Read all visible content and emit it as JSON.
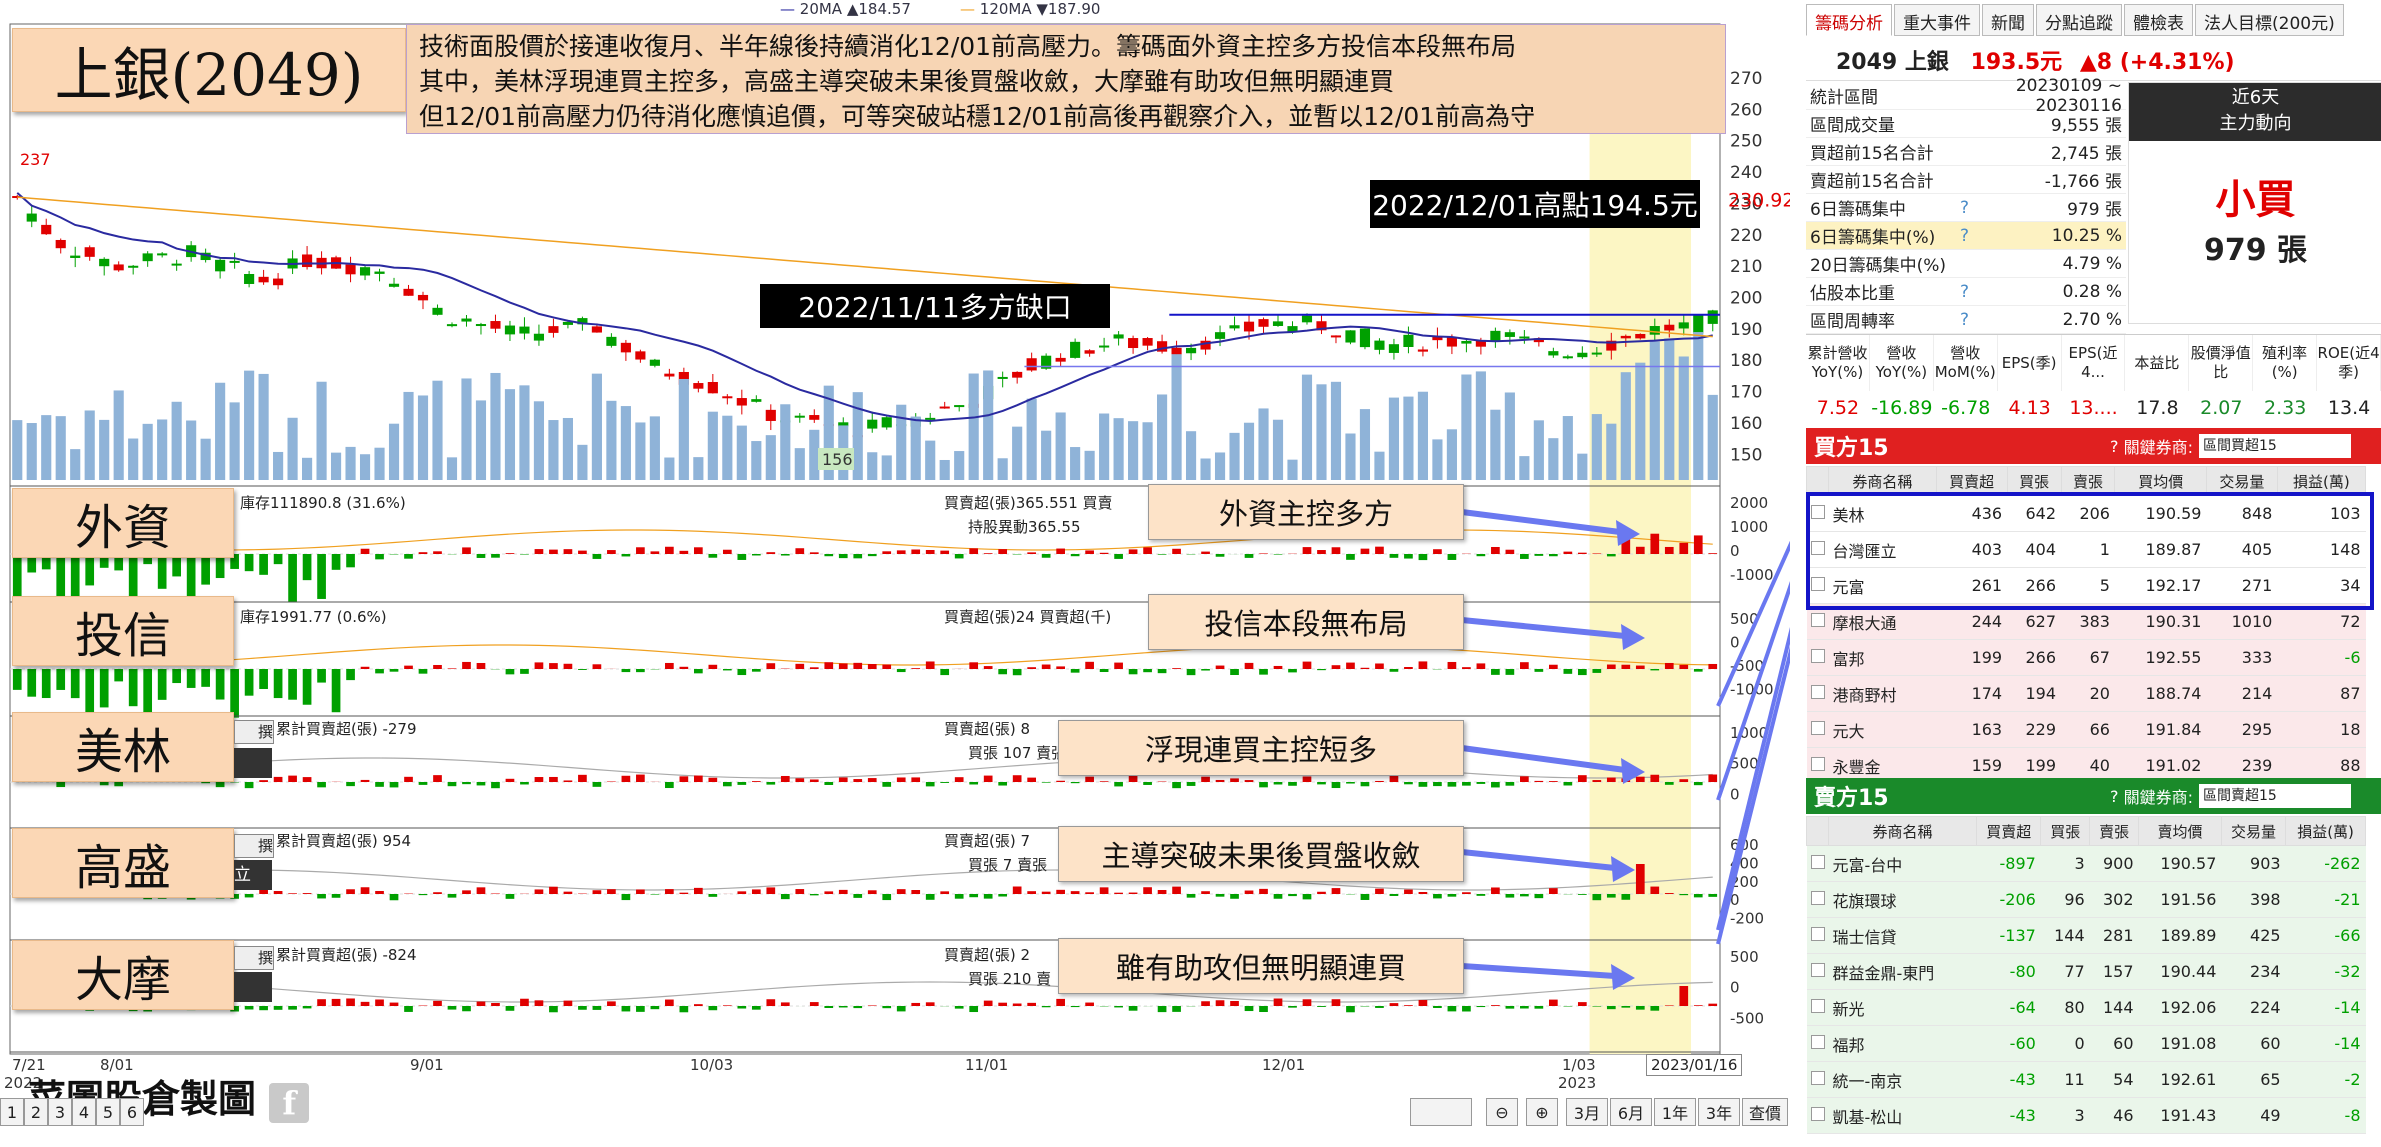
{
  "title": "上銀(2049)",
  "description": [
    "技術面股價於接連收復月、半年線後持續消化12/01前高壓力。籌碼面外資主控多方投信本段無布局",
    "其中，美林浮現連買主控多，高盛主導突破未果後買盤收斂，大摩雖有助攻但無明顯連買",
    "但12/01前高壓力仍待消化應慎追價，可等突破站穩12/01前高後再觀察介入，並暫以12/01前高為守"
  ],
  "legend": {
    "ma20": "20MA ▲184.57",
    "ma120": "120MA ▼187.90"
  },
  "annotations": {
    "high_label": "2022/12/01高點194.5元",
    "gap_label": "2022/11/11多方缺口",
    "max_price": "237",
    "min_price": "156",
    "price_marker": "230.92"
  },
  "price_axis": [
    "270",
    "260",
    "250",
    "240",
    "230",
    "220",
    "210",
    "200",
    "190",
    "180",
    "170",
    "160",
    "150"
  ],
  "x_axis": {
    "labels": [
      "7/21",
      "8/01",
      "9/01",
      "10/03",
      "11/01",
      "12/01",
      "1/03"
    ],
    "years": [
      "2022",
      "2023"
    ],
    "current_date": "2023/01/16"
  },
  "panels": [
    {
      "name": "外資",
      "info1": "庫存111890.8 (31.6%)",
      "info2": "買賣超(張)365.551 買賣",
      "info3": "持股異動365.55",
      "callout": "外資主控多方",
      "axis": [
        "2000",
        "1000",
        "0",
        "-1000"
      ]
    },
    {
      "name": "投信",
      "info1": "庫存1991.77 (0.6%)",
      "info2": "買賣超(張)24 買賣超(千)",
      "info3": "",
      "callout": "投信本段無布局",
      "axis": [
        "500",
        "0",
        "-500",
        "-1000"
      ]
    },
    {
      "name": "美林",
      "info1": "累計買賣超(張) -279",
      "info2": "買賣超(張) 8",
      "info3": "買張 107 賣張",
      "callout": "浮現連買主控短多",
      "axis": [
        "1000",
        "500",
        "0"
      ]
    },
    {
      "name": "高盛",
      "info1": "累計買賣超(張) 954",
      "info2": "買賣超(張) 7",
      "info3": "買張 7 賣張",
      "callout": "主導突破未果後買盤收斂",
      "axis": [
        "600",
        "400",
        "200",
        "0",
        "-200"
      ]
    },
    {
      "name": "大摩",
      "info1": "累計買賣超(張) -824",
      "info2": "買賣超(張) 2",
      "info3": "買張 210 賣",
      "callout": "雖有助攻但無明顯連買",
      "axis": [
        "500",
        "0",
        "-500"
      ]
    }
  ],
  "panel_side_labels": [
    "撰",
    "撰",
    "立",
    "撰"
  ],
  "watermark": "菜圖股倉製圖",
  "footer_buttons": [
    "3月",
    "6月",
    "1年",
    "3年",
    "查價"
  ],
  "footer_tabs": [
    "1",
    "2",
    "3",
    "4",
    "5",
    "6"
  ],
  "right_panel": {
    "tabs": [
      "籌碼分析",
      "重大事件",
      "新聞",
      "分點追蹤",
      "體檢表",
      "法人目標(200元)"
    ],
    "stock": {
      "code_name": "2049 上銀",
      "price": "193.5元",
      "change": "▲8 (+4.31%)"
    },
    "stats": [
      {
        "label": "統計區間",
        "value": "20230109 ~ 20230116",
        "q": ""
      },
      {
        "label": "區間成交量",
        "value": "9,555 張",
        "q": ""
      },
      {
        "label": "買超前15名合計",
        "value": "2,745 張",
        "q": ""
      },
      {
        "label": "賣超前15名合計",
        "value": "-1,766 張",
        "q": ""
      },
      {
        "label": "6日籌碼集中",
        "value": "979 張",
        "q": "?"
      },
      {
        "label": "6日籌碼集中(%)",
        "value": "10.25 %",
        "q": "?"
      },
      {
        "label": "20日籌碼集中(%)",
        "value": "4.79 %",
        "q": ""
      },
      {
        "label": "佔股本比重",
        "value": "0.28 %",
        "q": "?"
      },
      {
        "label": "區間周轉率",
        "value": "2.70 %",
        "q": "?"
      }
    ],
    "flow": {
      "period": "近6天",
      "title": "主力動向",
      "signal": "小買",
      "amount": "979 張"
    },
    "fin_headers": [
      "累計營收YoY(%)",
      "營收YoY(%)",
      "營收MoM(%)",
      "EPS(季)",
      "EPS(近4...",
      "本益比",
      "股價淨值比",
      "殖利率(%)",
      "ROE(近4季)"
    ],
    "fin_values": [
      "7.52",
      "-16.89",
      "-6.78",
      "4.13",
      "13....",
      "17.8",
      "2.07",
      "2.33",
      "13.4"
    ],
    "buy": {
      "title": "買方15",
      "filter_label": "關鍵券商:",
      "select": "區間買超15",
      "columns": [
        "券商名稱",
        "買賣超",
        "買張",
        "賣張",
        "買均價",
        "交易量",
        "損益(萬)"
      ],
      "rows": [
        [
          "美林",
          "436",
          "642",
          "206",
          "190.59",
          "848",
          "103"
        ],
        [
          "台灣匯立",
          "403",
          "404",
          "1",
          "189.87",
          "405",
          "148"
        ],
        [
          "元富",
          "261",
          "266",
          "5",
          "192.17",
          "271",
          "34"
        ],
        [
          "摩根大通",
          "244",
          "627",
          "383",
          "190.31",
          "1010",
          "72"
        ],
        [
          "富邦",
          "199",
          "266",
          "67",
          "192.55",
          "333",
          "-6"
        ],
        [
          "港商野村",
          "174",
          "194",
          "20",
          "188.74",
          "214",
          "87"
        ],
        [
          "元大",
          "163",
          "229",
          "66",
          "191.84",
          "295",
          "18"
        ],
        [
          "永豐金",
          "159",
          "199",
          "40",
          "191.02",
          "239",
          "88"
        ]
      ]
    },
    "sell": {
      "title": "賣方15",
      "filter_label": "關鍵券商:",
      "select": "區間賣超15",
      "columns": [
        "券商名稱",
        "買賣超",
        "買張",
        "賣張",
        "賣均價",
        "交易量",
        "損益(萬)"
      ],
      "rows": [
        [
          "元富-台中",
          "-897",
          "3",
          "900",
          "190.57",
          "903",
          "-262"
        ],
        [
          "花旗環球",
          "-206",
          "96",
          "302",
          "191.56",
          "398",
          "-21"
        ],
        [
          "瑞士信貸",
          "-137",
          "144",
          "281",
          "189.89",
          "425",
          "-66"
        ],
        [
          "群益金鼎-東門",
          "-80",
          "77",
          "157",
          "190.44",
          "234",
          "-32"
        ],
        [
          "新光",
          "-64",
          "80",
          "144",
          "192.06",
          "224",
          "-14"
        ],
        [
          "福邦",
          "-60",
          "0",
          "60",
          "191.08",
          "60",
          "-14"
        ],
        [
          "統一-南京",
          "-43",
          "11",
          "54",
          "192.61",
          "65",
          "-2"
        ],
        [
          "凱基-松山",
          "-43",
          "3",
          "46",
          "191.43",
          "49",
          "-8"
        ]
      ]
    }
  },
  "colors": {
    "up": "#e00000",
    "down": "#00a000",
    "ma20": "#2a2aa0",
    "ma120": "#f0a020",
    "buy_head": "#e02020",
    "sell_head": "#1a8a2a",
    "highlight": "#fcf6c4"
  }
}
